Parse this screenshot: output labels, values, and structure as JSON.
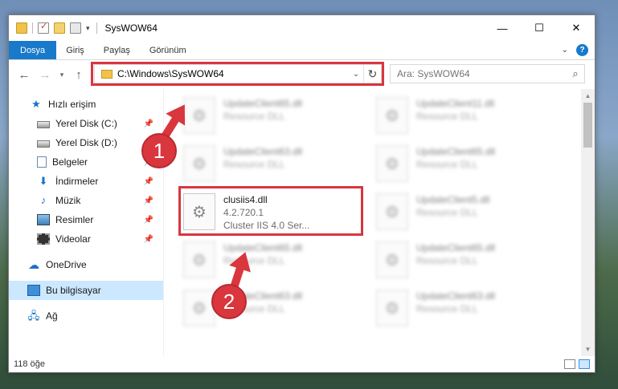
{
  "window": {
    "title": "SysWOW64"
  },
  "controls": {
    "minimize": "—",
    "maximize": "☐",
    "close": "✕"
  },
  "ribbon": {
    "tabs": [
      "Dosya",
      "Giriş",
      "Paylaş",
      "Görünüm"
    ],
    "help": "?"
  },
  "address": {
    "path": "C:\\Windows\\SysWOW64"
  },
  "search": {
    "placeholder": "Ara: SysWOW64"
  },
  "nav": {
    "quick_access": "Hızlı erişim",
    "items": [
      {
        "label": "Yerel Disk (C:)",
        "icon": "drive-icon",
        "pinned": true
      },
      {
        "label": "Yerel Disk (D:)",
        "icon": "drive-icon",
        "pinned": false
      },
      {
        "label": "Belgeler",
        "icon": "documents-icon",
        "pinned": true
      },
      {
        "label": "İndirmeler",
        "icon": "downloads-icon",
        "pinned": true
      },
      {
        "label": "Müzik",
        "icon": "music-icon",
        "pinned": true
      },
      {
        "label": "Resimler",
        "icon": "pictures-icon",
        "pinned": true
      },
      {
        "label": "Videolar",
        "icon": "videos-icon",
        "pinned": true
      }
    ],
    "onedrive": "OneDrive",
    "this_pc": "Bu bilgisayar",
    "network": "Ağ"
  },
  "files": [
    {
      "name": "UpdateClient65.dll",
      "desc": "Resource DLL",
      "col": 0,
      "row": 0,
      "blurred": true
    },
    {
      "name": "UpdateClient11.dll",
      "desc": "Resource DLL",
      "col": 1,
      "row": 0,
      "blurred": true
    },
    {
      "name": "UpdateClient63.dll",
      "desc": "Resource DLL",
      "col": 0,
      "row": 1,
      "blurred": true
    },
    {
      "name": "UpdateClient65.dll",
      "desc": "Resource DLL",
      "col": 1,
      "row": 1,
      "blurred": true
    },
    {
      "name": "clusiis4.dll",
      "version": "4.2.720.1",
      "desc": "Cluster IIS 4.0 Ser...",
      "col": 0,
      "row": 2,
      "blurred": false
    },
    {
      "name": "UpdateClient5.dll",
      "desc": "Resource DLL",
      "col": 1,
      "row": 2,
      "blurred": true
    },
    {
      "name": "UpdateClient65.dll",
      "desc": "Resource DLL",
      "col": 0,
      "row": 3,
      "blurred": true
    },
    {
      "name": "UpdateClient65.dll",
      "desc": "Resource DLL",
      "col": 1,
      "row": 3,
      "blurred": true
    },
    {
      "name": "UpdateClient63.dll",
      "desc": "Resource DLL",
      "col": 0,
      "row": 4,
      "blurred": true
    },
    {
      "name": "UpdateClient63.dll",
      "desc": "Resource DLL",
      "col": 1,
      "row": 4,
      "blurred": true
    }
  ],
  "status": {
    "count": "118 öğe"
  },
  "annotations": {
    "badge1": "1",
    "badge2": "2"
  },
  "colors": {
    "accent": "#1979ca",
    "highlight": "#d9363e",
    "selected": "#cce8ff"
  }
}
